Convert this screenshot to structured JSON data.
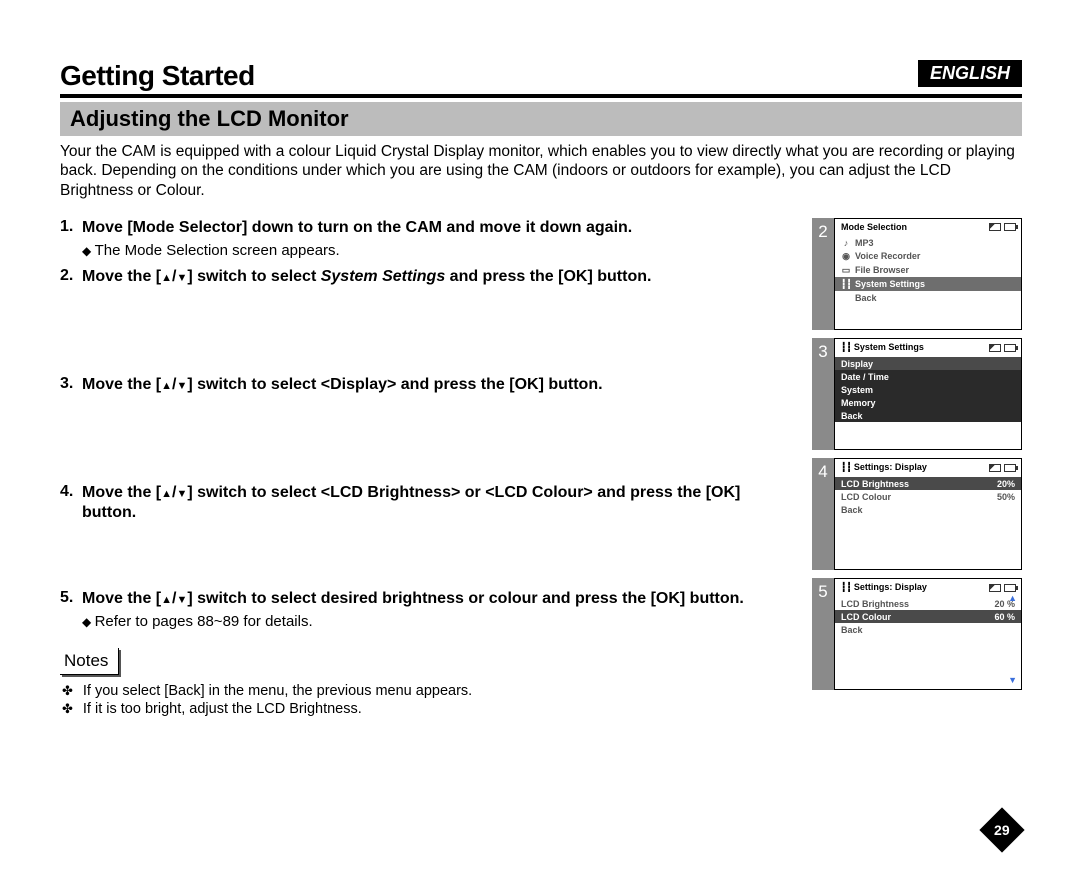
{
  "lang_badge": "ENGLISH",
  "chapter_title": "Getting Started",
  "section_title": "Adjusting the LCD Monitor",
  "intro": "Your the CAM is equipped with a colour Liquid Crystal Display monitor, which enables you to view directly what you are recording or playing back. Depending on the conditions under which you are using the CAM (indoors or outdoors for example), you can adjust the LCD Brightness or Colour.",
  "steps": {
    "s1": {
      "num": "1.",
      "heading": "Move [Mode Selector] down to turn on the CAM and move it down again.",
      "sub": "The Mode Selection screen appears."
    },
    "s2": {
      "num": "2.",
      "pre": "Move the [",
      "mid": "] switch to select ",
      "sel": "System Settings",
      "post": " and press the [OK] button."
    },
    "s3": {
      "num": "3.",
      "pre": "Move the [",
      "post": "] switch to select <Display> and press the [OK] button."
    },
    "s4": {
      "num": "4.",
      "pre": "Move the [",
      "post": "] switch to select <LCD Brightness> or <LCD Colour> and press the [OK] button."
    },
    "s5": {
      "num": "5.",
      "pre": "Move the [",
      "post": "] switch to select desired brightness or colour and press the [OK] button.",
      "sub": "Refer to pages 88~89 for details."
    }
  },
  "notes_label": "Notes",
  "notes": {
    "n1": "If you select [Back] in the menu, the previous menu appears.",
    "n2": "If it is too bright, adjust the LCD Brightness."
  },
  "screens": {
    "s2": {
      "tag": "2",
      "title": "Mode Selection",
      "items": {
        "i1": "MP3",
        "i2": "Voice Recorder",
        "i3": "File Browser",
        "i4": "System Settings",
        "i5": "Back"
      }
    },
    "s3": {
      "tag": "3",
      "title": "System Settings",
      "items": {
        "i1": "Display",
        "i2": "Date / Time",
        "i3": "System",
        "i4": "Memory",
        "i5": "Back"
      }
    },
    "s4": {
      "tag": "4",
      "title": "Settings: Display",
      "items": {
        "i1": {
          "label": "LCD Brightness",
          "value": "20%"
        },
        "i2": {
          "label": "LCD Colour",
          "value": "50%"
        },
        "i3": {
          "label": "Back"
        }
      }
    },
    "s5": {
      "tag": "5",
      "title": "Settings: Display",
      "items": {
        "i1": {
          "label": "LCD Brightness",
          "value": "20 %"
        },
        "i2": {
          "label": "LCD Colour",
          "value": "60 %"
        },
        "i3": {
          "label": "Back"
        }
      }
    }
  },
  "page_number": "29"
}
